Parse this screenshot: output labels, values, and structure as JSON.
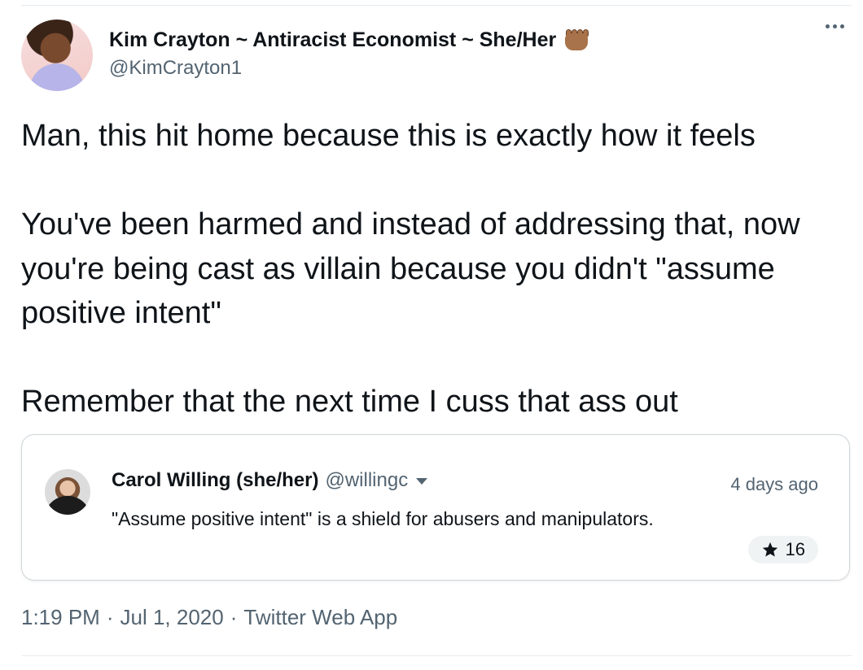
{
  "tweet": {
    "author_name": "Kim Crayton ~ Antiracist Economist ~ She/Her",
    "author_emoji_icon": "raised-fist-icon",
    "author_handle": "@KimCrayton1",
    "text": "Man, this hit home because this is exactly how it feels\n\nYou've been harmed and instead of addressing that, now you're being cast as villain because you didn't \"assume positive intent\"\n\nRemember that the next time I cuss that ass out",
    "time": "1:19 PM",
    "date": "Jul 1, 2020",
    "source": "Twitter Web App",
    "separator": "·"
  },
  "quoted": {
    "author_name": "Carol Willing (she/her)",
    "author_handle": "@willingc",
    "relative_time": "4 days ago",
    "text": "\"Assume positive intent\" is a shield for abusers and manipulators.",
    "likes": "16"
  },
  "colors": {
    "text": "#0f1419",
    "secondary": "#536471",
    "border": "#d0d6da",
    "pill_bg": "#eff3f4"
  }
}
